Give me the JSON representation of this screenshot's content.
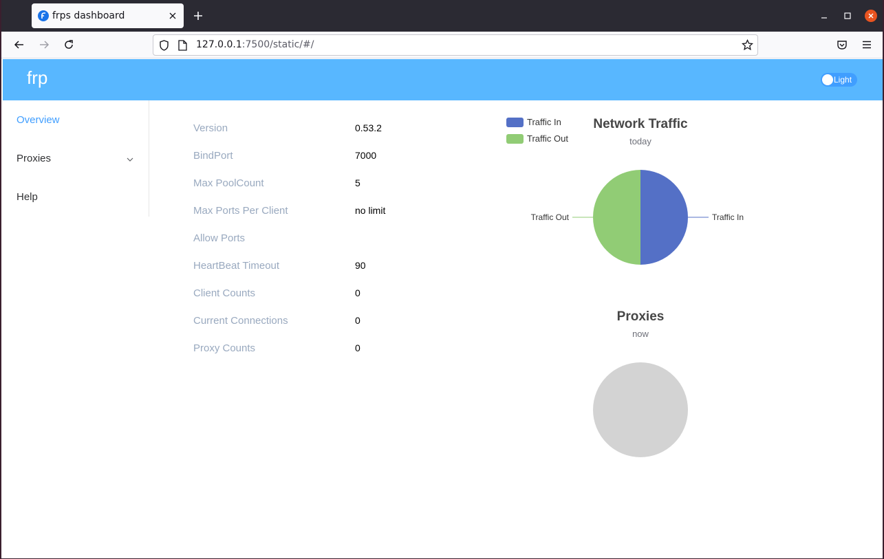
{
  "browser": {
    "tab_title": "frps dashboard",
    "url_host": "127.0.0.1",
    "url_rest": ":7500/static/#/"
  },
  "header": {
    "brand": "frp",
    "theme_toggle_label": "Light"
  },
  "sidebar": {
    "items": [
      {
        "label": "Overview",
        "active": true
      },
      {
        "label": "Proxies",
        "active": false,
        "expandable": true
      },
      {
        "label": "Help",
        "active": false
      }
    ]
  },
  "server_info": [
    {
      "label": "Version",
      "value": "0.53.2"
    },
    {
      "label": "BindPort",
      "value": "7000"
    },
    {
      "label": "Max PoolCount",
      "value": "5"
    },
    {
      "label": "Max Ports Per Client",
      "value": "no limit"
    },
    {
      "label": "Allow Ports",
      "value": ""
    },
    {
      "label": "HeartBeat Timeout",
      "value": "90"
    },
    {
      "label": "Client Counts",
      "value": "0"
    },
    {
      "label": "Current Connections",
      "value": "0"
    },
    {
      "label": "Proxy Counts",
      "value": "0"
    }
  ],
  "colors": {
    "accent": "#409eff",
    "header_bg": "#58b7ff",
    "traffic_in": "#5470c6",
    "traffic_out": "#91cc75",
    "empty_pie": "#d3d3d3"
  },
  "chart_data": [
    {
      "type": "pie",
      "title": "Network Traffic",
      "subtitle": "today",
      "legend_position": "top-left",
      "categories": [
        "Traffic In",
        "Traffic Out"
      ],
      "values": [
        50,
        50
      ]
    },
    {
      "type": "pie",
      "title": "Proxies",
      "subtitle": "now",
      "categories": [],
      "values": []
    }
  ]
}
